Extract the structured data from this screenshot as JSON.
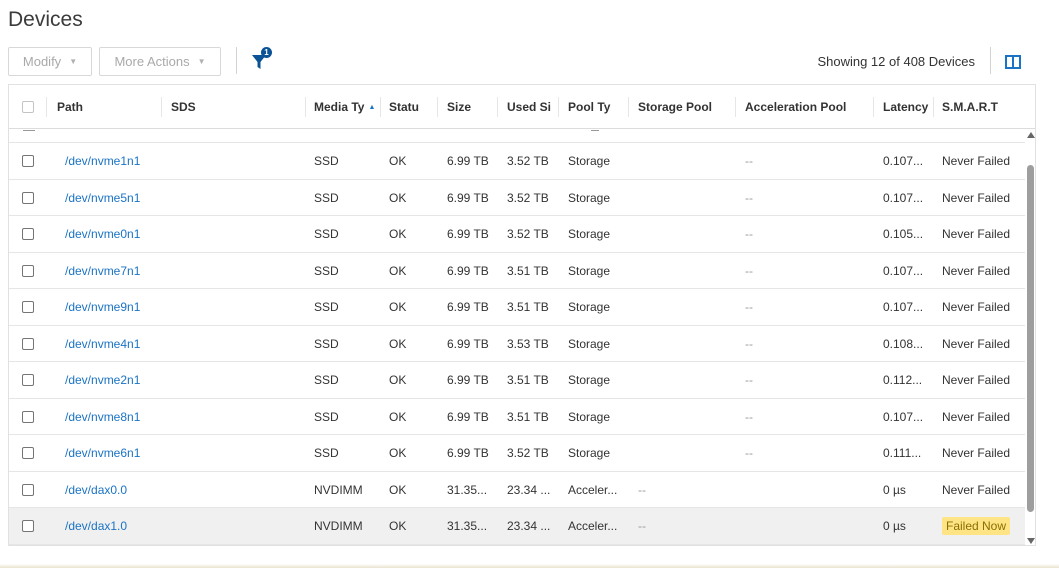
{
  "page": {
    "title": "Devices"
  },
  "toolbar": {
    "modify_label": "Modify",
    "more_actions_label": "More Actions",
    "filter_count": "1",
    "showing_text": "Showing 12 of 408 Devices"
  },
  "columns": [
    "Path",
    "SDS",
    "Media Ty",
    "Statu",
    "Size",
    "Used Si",
    "Pool Ty",
    "Storage Pool",
    "Acceleration Pool",
    "Latency",
    "S.M.A.R.T"
  ],
  "sort": {
    "column": "Media Ty",
    "direction": "ascending"
  },
  "rows": [
    {
      "path": "/dev/nvme1n1",
      "sds": "",
      "media": "SSD",
      "status": "OK",
      "size": "6.99 TB",
      "used": "3.52 TB",
      "pool_type": "Storage",
      "storage_pool": "",
      "accel_pool": "--",
      "latency": "0.107...",
      "smart": "Never Failed"
    },
    {
      "path": "/dev/nvme5n1",
      "sds": "",
      "media": "SSD",
      "status": "OK",
      "size": "6.99 TB",
      "used": "3.52 TB",
      "pool_type": "Storage",
      "storage_pool": "",
      "accel_pool": "--",
      "latency": "0.107...",
      "smart": "Never Failed"
    },
    {
      "path": "/dev/nvme0n1",
      "sds": "",
      "media": "SSD",
      "status": "OK",
      "size": "6.99 TB",
      "used": "3.52 TB",
      "pool_type": "Storage",
      "storage_pool": "",
      "accel_pool": "--",
      "latency": "0.105...",
      "smart": "Never Failed"
    },
    {
      "path": "/dev/nvme7n1",
      "sds": "",
      "media": "SSD",
      "status": "OK",
      "size": "6.99 TB",
      "used": "3.51 TB",
      "pool_type": "Storage",
      "storage_pool": "",
      "accel_pool": "--",
      "latency": "0.107...",
      "smart": "Never Failed"
    },
    {
      "path": "/dev/nvme9n1",
      "sds": "",
      "media": "SSD",
      "status": "OK",
      "size": "6.99 TB",
      "used": "3.51 TB",
      "pool_type": "Storage",
      "storage_pool": "",
      "accel_pool": "--",
      "latency": "0.107...",
      "smart": "Never Failed"
    },
    {
      "path": "/dev/nvme4n1",
      "sds": "",
      "media": "SSD",
      "status": "OK",
      "size": "6.99 TB",
      "used": "3.53 TB",
      "pool_type": "Storage",
      "storage_pool": "",
      "accel_pool": "--",
      "latency": "0.108...",
      "smart": "Never Failed"
    },
    {
      "path": "/dev/nvme2n1",
      "sds": "",
      "media": "SSD",
      "status": "OK",
      "size": "6.99 TB",
      "used": "3.51 TB",
      "pool_type": "Storage",
      "storage_pool": "",
      "accel_pool": "--",
      "latency": "0.112...",
      "smart": "Never Failed"
    },
    {
      "path": "/dev/nvme8n1",
      "sds": "",
      "media": "SSD",
      "status": "OK",
      "size": "6.99 TB",
      "used": "3.51 TB",
      "pool_type": "Storage",
      "storage_pool": "",
      "accel_pool": "--",
      "latency": "0.107...",
      "smart": "Never Failed"
    },
    {
      "path": "/dev/nvme6n1",
      "sds": "",
      "media": "SSD",
      "status": "OK",
      "size": "6.99 TB",
      "used": "3.52 TB",
      "pool_type": "Storage",
      "storage_pool": "",
      "accel_pool": "--",
      "latency": "0.111...",
      "smart": "Never Failed"
    },
    {
      "path": "/dev/dax0.0",
      "sds": "",
      "media": "NVDIMM",
      "status": "OK",
      "size": "31.35...",
      "used": "23.34 ...",
      "pool_type": "Acceler...",
      "storage_pool": "--",
      "accel_pool": "",
      "latency": "0 µs",
      "smart": "Never Failed"
    },
    {
      "path": "/dev/dax1.0",
      "sds": "",
      "media": "NVDIMM",
      "status": "OK",
      "size": "31.35...",
      "used": "23.34 ...",
      "pool_type": "Acceler...",
      "storage_pool": "--",
      "accel_pool": "",
      "latency": "0 µs",
      "smart": "Failed Now",
      "smart_failed": true,
      "selected": true
    }
  ],
  "colors": {
    "accent": "#1a73c4",
    "failed_badge": "#ffe485",
    "filter_badge": "#0b5394"
  },
  "icons": {
    "filter": "funnel-icon",
    "columns": "column-toggle-icon",
    "sort": "sort-ascending-icon"
  }
}
